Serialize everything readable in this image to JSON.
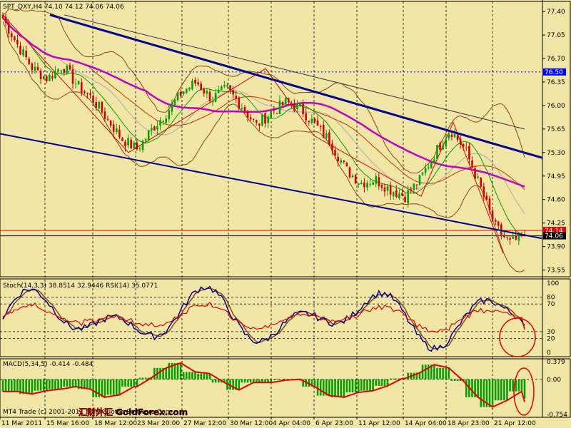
{
  "theme": {
    "background": "#f2e6a6",
    "grid": "#000000",
    "candle_up": "#00a000",
    "candle_down": "#cc0000",
    "trend_line": "#00008b",
    "ma_magenta": "#c000c0",
    "bollinger": "#8b4513",
    "stoch_main": "#00008b",
    "stoch_signal": "#8b4513",
    "rsi": "#e00000",
    "macd_hist": "#00a000",
    "macd_signal": "#e00000",
    "annotation": "#e00000"
  },
  "price_panel": {
    "header": "SPT_DXY,H4  74.10 74.12 74.06 74.06",
    "y_ticks": [
      "77.40",
      "77.05",
      "76.70",
      "76.35",
      "76.00",
      "75.65",
      "75.30",
      "74.95",
      "74.60",
      "74.25",
      "73.90",
      "73.55"
    ],
    "markers": [
      {
        "label": "76.50",
        "value": 76.5,
        "color": "#0000ff"
      },
      {
        "label": "74.14",
        "value": 74.14,
        "color": "#e00000"
      },
      {
        "label": "74.06",
        "value": 74.06,
        "color": "#000000"
      }
    ]
  },
  "stoch_panel": {
    "header": "Stoch(14,3,3) 38.8514 32.9446  RSI(14) 35.0771",
    "levels": [
      "100",
      "80",
      "70",
      "30",
      "20",
      "0"
    ]
  },
  "macd_panel": {
    "header": "MACD(5,34,5) -0.414 -0.484",
    "levels": [
      "0.379",
      "0.00",
      "-0.754"
    ]
  },
  "footer": {
    "copyright": "MT4 Trade (c) 2001-2011 MetaQuotes Software Corp.",
    "watermark": "汇财外汇 GoldForex.com",
    "date_labels": [
      "11 Mar 2011",
      "15 Mar 16:00",
      "18 Mar 12:00",
      "23 Mar 20:00",
      "27 Mar 12:00",
      "30 Mar 12:00",
      "4 Apr 04:00",
      "6 Apr 23:00",
      "11 Apr 12:00",
      "14 Apr 04:00",
      "18 Apr 23:00",
      "21 Apr 12:00"
    ]
  },
  "chart_data": {
    "type": "candlestick",
    "symbol": "SPT_DXY",
    "timeframe": "H4",
    "last_bar": {
      "open": 74.1,
      "high": 74.12,
      "low": 74.06,
      "close": 74.06
    },
    "y_range": [
      73.45,
      77.55
    ],
    "close_path": [
      77.3,
      76.9,
      76.55,
      76.4,
      76.6,
      76.3,
      76.1,
      75.8,
      75.5,
      75.35,
      75.65,
      75.9,
      76.2,
      76.35,
      76.1,
      76.25,
      76.0,
      75.7,
      75.9,
      76.05,
      75.95,
      75.7,
      75.45,
      75.05,
      74.85,
      74.9,
      74.75,
      74.65,
      74.9,
      75.3,
      75.65,
      75.35,
      74.8,
      74.2,
      73.95,
      74.06
    ],
    "indicators": {
      "stoch_main": 38.8514,
      "stoch_signal": 32.9446,
      "rsi": 35.0771,
      "macd_main": -0.414,
      "macd_signal": -0.484
    }
  }
}
